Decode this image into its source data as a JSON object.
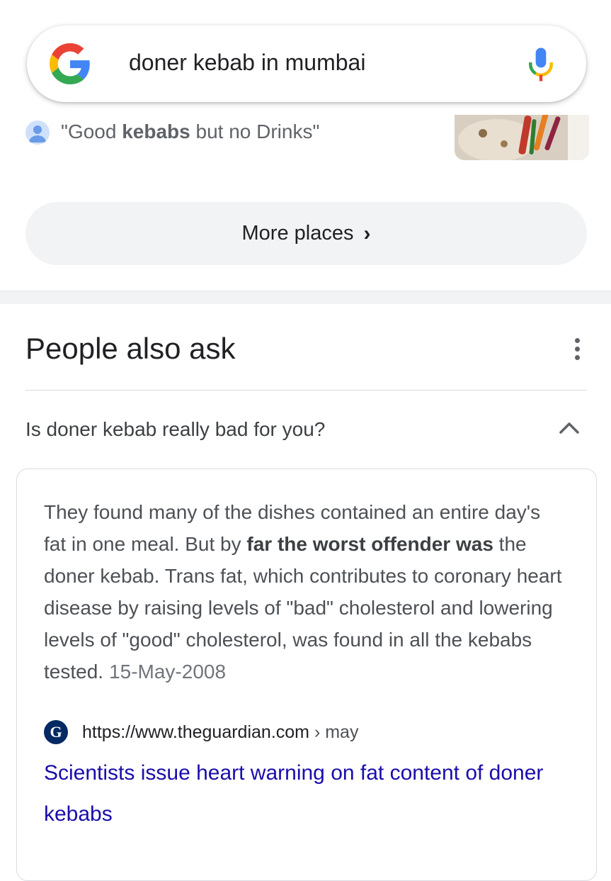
{
  "search": {
    "query": "doner kebab in mumbai",
    "logo_icon": "google-g-logo",
    "mic_icon": "mic-icon"
  },
  "review": {
    "quote_prefix": "\"Good ",
    "quote_bold": "kebabs",
    "quote_suffix": " but no Drinks\""
  },
  "more_places": {
    "label": "More places",
    "chevron": "›"
  },
  "people_also_ask": {
    "title": "People also ask",
    "question": "Is doner kebab really bad for you?",
    "answer": {
      "part1": "They found many of the dishes contained an entire day's fat in one meal. But by ",
      "bold": "far the worst offender was",
      "part2": " the doner kebab. Trans fat, which contributes to coronary heart disease by raising levels of \"bad\" cholesterol and lowering levels of \"good\" cholesterol, was found in all the kebabs tested.",
      "date": "15-May-2008"
    },
    "source": {
      "url": "https://www.theguardian.com",
      "crumb": " › may",
      "favicon_letter": "G"
    },
    "result_title": "Scientists issue heart warning on fat content of doner kebabs"
  },
  "colors": {
    "link": "#1a0dab",
    "chip_bg": "#f1f3f4",
    "guardian": "#052962"
  }
}
